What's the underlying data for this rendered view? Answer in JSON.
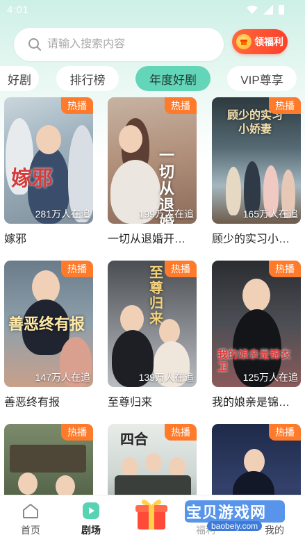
{
  "status_bar": {
    "time": "4:01"
  },
  "search": {
    "placeholder": "请输入搜索内容"
  },
  "welfare": {
    "label": "领福利"
  },
  "tabs": [
    {
      "label": "好剧",
      "active": false
    },
    {
      "label": "排行榜",
      "active": false
    },
    {
      "label": "年度好剧",
      "active": true
    },
    {
      "label": "VIP尊享",
      "active": false
    }
  ],
  "hot_tag": "热播",
  "dramas": [
    {
      "title": "嫁邪",
      "followers": "281万人在追",
      "poster_text": "嫁邪"
    },
    {
      "title": "一切从退婚开…",
      "followers": "199万人在追",
      "poster_text": "一切从退婚开"
    },
    {
      "title": "顾少的实习小…",
      "followers": "165万人在追",
      "poster_text": "顾少的实习小娇妻"
    },
    {
      "title": "善恶终有报",
      "followers": "147万人在追",
      "poster_text": "善恶终有报"
    },
    {
      "title": "至尊归来",
      "followers": "139万人在追",
      "poster_text": "至尊归来"
    },
    {
      "title": "我的娘亲是锦…",
      "followers": "125万人在追",
      "poster_text": "我的娘亲是锦衣卫"
    },
    {
      "title": "",
      "followers": "",
      "poster_text": ""
    },
    {
      "title": "",
      "followers": "",
      "poster_text": "四合"
    },
    {
      "title": "",
      "followers": "",
      "poster_text": ""
    }
  ],
  "bottom_nav": [
    {
      "label": "首页",
      "icon": "home-icon"
    },
    {
      "label": "剧场",
      "icon": "play-icon",
      "active": true
    },
    {
      "label": "",
      "icon": "gift-box-icon"
    },
    {
      "label": "福利",
      "icon": "welfare-icon"
    },
    {
      "label": "我的",
      "icon": "profile-icon"
    }
  ],
  "watermark": {
    "text": "宝贝游戏网",
    "url": "baobeiy.com"
  },
  "colors": {
    "accent": "#63d5b8",
    "hot": "#ff7a2a",
    "welfare": "#ff4a2e"
  }
}
